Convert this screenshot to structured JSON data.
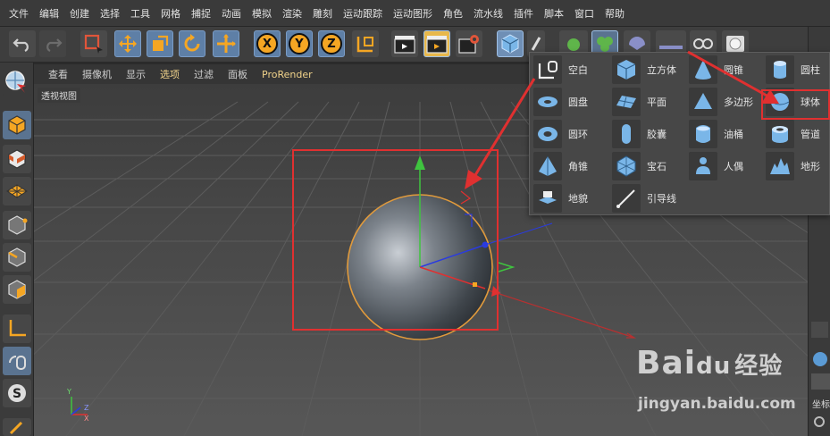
{
  "menubar": {
    "items": [
      "文件",
      "编辑",
      "创建",
      "选择",
      "工具",
      "网格",
      "捕捉",
      "动画",
      "模拟",
      "渲染",
      "雕刻",
      "运动跟踪",
      "运动图形",
      "角色",
      "流水线",
      "插件",
      "脚本",
      "窗口",
      "帮助"
    ]
  },
  "toolbar": {
    "axis_x": "X",
    "axis_y": "Y",
    "axis_z": "Z"
  },
  "viewbar": {
    "items": [
      "查看",
      "摄像机",
      "显示",
      "选项",
      "过滤",
      "面板",
      "ProRender"
    ],
    "selected": "选项"
  },
  "viewport": {
    "label": "透视视图",
    "axis_y": "Y",
    "axis_z": "Z",
    "axis_x": "X"
  },
  "popup": {
    "items": [
      {
        "label": "空白",
        "icon": "null-object-icon"
      },
      {
        "label": "立方体",
        "icon": "cube-icon"
      },
      {
        "label": "圆锥",
        "icon": "cone-icon"
      },
      {
        "label": "圆柱",
        "icon": "cylinder-icon"
      },
      {
        "label": "圆盘",
        "icon": "disc-icon"
      },
      {
        "label": "平面",
        "icon": "plane-icon"
      },
      {
        "label": "多边形",
        "icon": "polygon-icon"
      },
      {
        "label": "球体",
        "icon": "sphere-icon"
      },
      {
        "label": "圆环",
        "icon": "torus-icon"
      },
      {
        "label": "胶囊",
        "icon": "capsule-icon"
      },
      {
        "label": "油桶",
        "icon": "oil-tank-icon"
      },
      {
        "label": "管道",
        "icon": "tube-icon"
      },
      {
        "label": "角锥",
        "icon": "pyramid-icon"
      },
      {
        "label": "宝石",
        "icon": "gem-icon"
      },
      {
        "label": "人偶",
        "icon": "figure-icon"
      },
      {
        "label": "地形",
        "icon": "landscape-icon"
      },
      {
        "label": "地貌",
        "icon": "relief-icon"
      },
      {
        "label": "引导线",
        "icon": "guide-icon"
      }
    ]
  },
  "rightpanel": {
    "coord_label": "坐标"
  },
  "watermark": {
    "brand": "Bai",
    "brand_mid": "du",
    "brand_cn": "经验",
    "url": "jingyan.baidu.com"
  },
  "colors": {
    "accent_blue": "#5e7fa6",
    "annotation_red": "#e03030",
    "highlight_yellow": "#f0d28a"
  }
}
